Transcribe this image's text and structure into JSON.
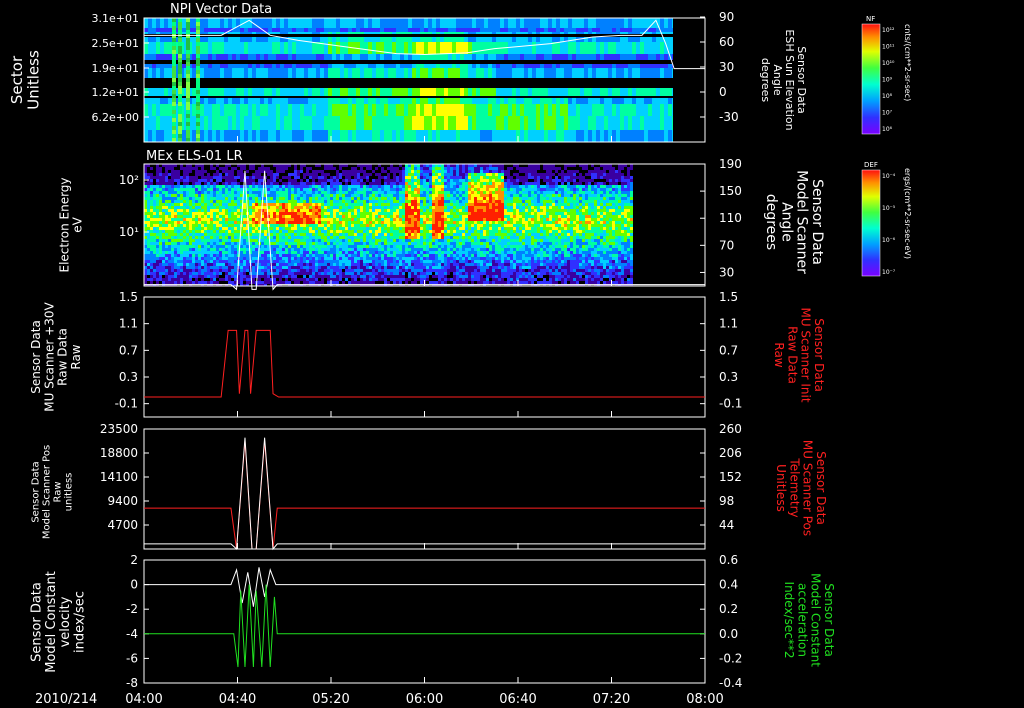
{
  "date_label": "2010/214",
  "x_ticks": [
    "04:00",
    "04:40",
    "05:20",
    "06:00",
    "06:40",
    "07:20",
    "08:00"
  ],
  "colors": {
    "background": "#000000",
    "axes": "#ffffff",
    "red_trace": "#ff2020",
    "green_trace": "#20e020",
    "spectrogram_palette": [
      "#3a00a0",
      "#3030ff",
      "#0080ff",
      "#00d0ff",
      "#00ffa0",
      "#60ff00",
      "#ffff00",
      "#ff9000",
      "#ff2000"
    ]
  },
  "chart_data": [
    {
      "type": "heatmap",
      "title": "NPI Vector Data",
      "ylabel": [
        "Sector",
        "Unitless"
      ],
      "y_ticks": [
        "3.1e+01",
        "2.5e+01",
        "1.9e+01",
        "1.2e+01",
        "6.2e+00"
      ],
      "y2_label": [
        "Sensor Data",
        "ESH Sun Elevation",
        "Angle",
        "degrees"
      ],
      "y2_ticks": [
        "90",
        "60",
        "30",
        "0",
        "-30"
      ],
      "colorbar": {
        "label": "NF",
        "units": "cnts/(cm**2-sr-sec)",
        "tick_labels": [
          "10¹²",
          "10¹¹",
          "10¹⁰",
          "10⁹",
          "10⁸",
          "10⁷",
          "10⁶"
        ]
      },
      "overlay_line": {
        "name": "ESH Sun Elevation Angle",
        "x_hours": [
          4.0,
          4.08,
          4.16,
          4.32,
          4.55,
          4.75,
          4.9,
          5.1,
          5.4,
          5.8,
          6.0,
          6.3,
          6.5,
          6.9,
          7.2,
          7.4,
          7.55,
          7.65,
          7.72,
          7.78,
          8.0
        ],
        "y_deg": [
          68,
          68,
          68,
          68,
          68,
          86,
          68,
          62,
          55,
          46,
          45,
          47,
          52,
          58,
          66,
          68,
          68,
          86,
          58,
          28,
          28
        ]
      }
    },
    {
      "type": "heatmap",
      "title": "MEx ELS-01 LR",
      "ylabel": [
        "Electron Energy",
        "eV"
      ],
      "y_ticks": [
        "10²",
        "10¹"
      ],
      "y2_label": [
        "Sensor Data",
        "Model Scanner",
        "Angle",
        "degrees"
      ],
      "y2_ticks": [
        "190",
        "150",
        "110",
        "70",
        "30"
      ],
      "colorbar": {
        "label": "DEF",
        "units": "ergs/(cm**2-sr-sec-eV)",
        "tick_labels": [
          "10⁻⁴",
          "10⁻⁵",
          "10⁻⁶",
          "10⁻⁷"
        ]
      }
    },
    {
      "type": "line",
      "ylabel": [
        "Sensor Data",
        "MU Scanner +30V",
        "Raw Data",
        "Raw"
      ],
      "y_ticks": [
        "1.5",
        "1.1",
        "0.7",
        "0.3",
        "-0.1"
      ],
      "ylim": [
        -0.3,
        1.5
      ],
      "y2_label": [
        "Sensor Data",
        "MU Scanner Init",
        "Raw Data",
        "Raw"
      ],
      "y2_ticks": [
        "1.5",
        "1.1",
        "0.7",
        "0.3",
        "-0.1"
      ],
      "series": [
        {
          "name": "MU Scanner Init Raw Data",
          "color": "red",
          "x_hours": [
            4.0,
            4.55,
            4.6,
            4.66,
            4.68,
            4.72,
            4.74,
            4.76,
            4.8,
            4.82,
            4.9,
            4.92,
            4.96,
            8.0
          ],
          "y": [
            0,
            0,
            1,
            1,
            0.05,
            1,
            1,
            0.05,
            1,
            1,
            1,
            0.05,
            0,
            0
          ]
        }
      ]
    },
    {
      "type": "line",
      "ylabel": [
        "Sensor Data",
        "Model Scanner Pos",
        "Raw",
        "unitless"
      ],
      "y_ticks": [
        "23500",
        "18800",
        "14100",
        "9400",
        "4700"
      ],
      "ylim": [
        0,
        23500
      ],
      "y2_label": [
        "Sensor Data",
        "MU Scanner Pos",
        "Telemetry",
        "Unitless"
      ],
      "y2_ticks": [
        "260",
        "206",
        "152",
        "98",
        "44"
      ],
      "series": [
        {
          "name": "MU Scanner Pos Telemetry",
          "color": "red",
          "x_hours": [
            4.0,
            4.62,
            4.66,
            4.72,
            4.77,
            4.8,
            4.86,
            4.92,
            4.95,
            8.0
          ],
          "y": [
            8000,
            8000,
            0,
            21200,
            0,
            0,
            21200,
            0,
            8000,
            8000
          ]
        },
        {
          "name": "Model Scanner Pos Raw",
          "color": "white",
          "x_hours": [
            4.0,
            4.62,
            4.66,
            4.72,
            4.77,
            4.8,
            4.86,
            4.92,
            4.95,
            8.0
          ],
          "y": [
            1000,
            1000,
            0,
            21800,
            0,
            0,
            21800,
            0,
            1000,
            1000
          ]
        }
      ]
    },
    {
      "type": "line",
      "ylabel": [
        "Sensor Data",
        "Model Constant",
        "velocity",
        "index/sec"
      ],
      "y_ticks": [
        "2",
        "0",
        "-2",
        "-4",
        "-6",
        "-8"
      ],
      "ylim": [
        -8,
        2
      ],
      "y2_label": [
        "Sensor Data",
        "Model Constant",
        "acceleration",
        "Index/sec**2"
      ],
      "y2_ticks": [
        "0.6",
        "0.4",
        "0.2",
        "0.0",
        "-0.2",
        "-0.4"
      ],
      "series": [
        {
          "name": "Model Constant velocity",
          "color": "white",
          "x_hours": [
            4.0,
            4.62,
            4.66,
            4.7,
            4.74,
            4.78,
            4.82,
            4.86,
            4.9,
            4.94,
            8.0
          ],
          "y": [
            0,
            0,
            1.2,
            -1.5,
            1.0,
            -1.8,
            1.4,
            -1.0,
            1.2,
            0,
            0
          ]
        },
        {
          "name": "Model Constant acceleration",
          "color": "green",
          "x_hours": [
            4.0,
            4.64,
            4.67,
            4.69,
            4.72,
            4.75,
            4.78,
            4.8,
            4.84,
            4.87,
            4.9,
            4.93,
            4.95,
            8.0
          ],
          "y": [
            0,
            0,
            -0.27,
            0.35,
            -0.27,
            0.4,
            -0.27,
            0.35,
            -0.27,
            0.4,
            -0.27,
            0.3,
            0,
            0
          ]
        }
      ]
    }
  ]
}
